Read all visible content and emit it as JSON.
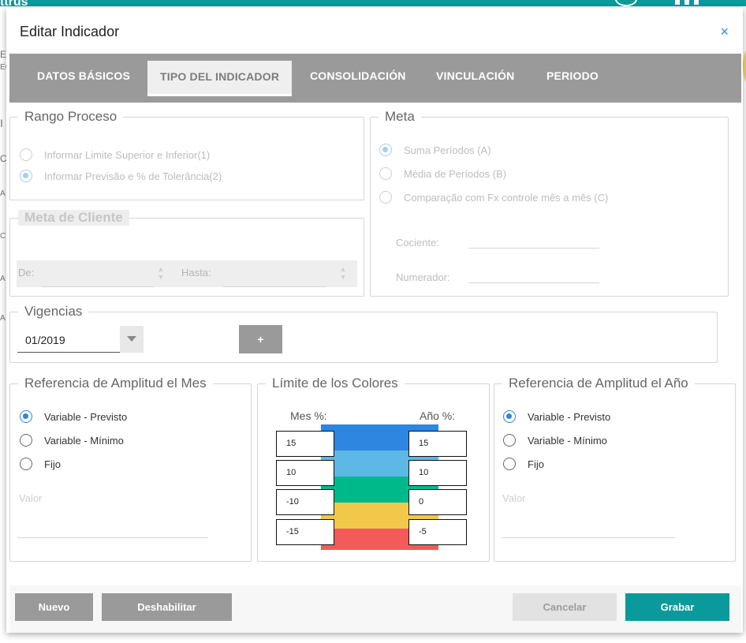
{
  "background": {
    "brand_fragment": "ttrus",
    "left_fragments": [
      "E",
      "EC",
      "I",
      "C",
      "A",
      "C",
      "A",
      "A"
    ]
  },
  "dialog": {
    "title": "Editar Indicador",
    "close_label": "×"
  },
  "tabs": [
    {
      "label": "DATOS BÁSICOS",
      "active": false
    },
    {
      "label": "TIPO DEL INDICADOR",
      "active": true
    },
    {
      "label": "CONSOLIDACIÓN",
      "active": false
    },
    {
      "label": "VINCULACIÓN",
      "active": false
    },
    {
      "label": "PERIODO",
      "active": false
    }
  ],
  "rango_proceso": {
    "legend": "Rango Proceso",
    "options": [
      {
        "label": "Informar Limite Superior e Inferior(1)",
        "checked": false,
        "disabled": true
      },
      {
        "label": "Informar Previsão e % de Tolerância(2)",
        "checked": true,
        "disabled": true
      }
    ]
  },
  "meta": {
    "legend": "Meta",
    "options": [
      {
        "label": "Suma Períodos (A)",
        "checked": true,
        "disabled": true
      },
      {
        "label": "Média de Períodos (B)",
        "checked": false,
        "disabled": true
      },
      {
        "label": "Comparação com Fx controle mês a mês (C)",
        "checked": false,
        "disabled": true
      }
    ],
    "cociente_label": "Cociente:",
    "numerador_label": "Numerador:"
  },
  "meta_cliente": {
    "legend": "Meta de Cliente",
    "de_label": "De:",
    "hasta_label": "Hasta:"
  },
  "vigencias": {
    "legend": "Vigencias",
    "selected": "01/2019",
    "add_label": "+"
  },
  "ref_mes": {
    "legend": "Referencia de Amplitud el Mes",
    "options": [
      {
        "label": "Variable - Previsto",
        "checked": true
      },
      {
        "label": "Variable - Mínimo",
        "checked": false
      },
      {
        "label": "Fijo",
        "checked": false
      }
    ],
    "valor_placeholder": "Valor"
  },
  "limite_colores": {
    "legend": "Límite de los Colores",
    "mes_label": "Mes %:",
    "ano_label": "Año %:",
    "band_colors": [
      "#2e86e0",
      "#5db8e6",
      "#00b98a",
      "#f2c84b",
      "#f45a5a"
    ],
    "mes_values": [
      "15",
      "10",
      "-10",
      "-15"
    ],
    "ano_values": [
      "15",
      "10",
      "0",
      "-5"
    ]
  },
  "ref_ano": {
    "legend": "Referencia de Amplitud el Año",
    "options": [
      {
        "label": "Variable - Previsto",
        "checked": true
      },
      {
        "label": "Variable - Mínimo",
        "checked": false
      },
      {
        "label": "Fijo",
        "checked": false
      }
    ],
    "valor_placeholder": "Valor"
  },
  "footer": {
    "nuevo": "Nuevo",
    "deshabilitar": "Deshabilitar",
    "cancelar": "Cancelar",
    "grabar": "Grabar"
  },
  "colors": {
    "accent": "#2f86d8",
    "primary_button": "#0b9a9c",
    "secondary_button": "#9a9a9a",
    "disabled_button": "#e0e0e0"
  }
}
